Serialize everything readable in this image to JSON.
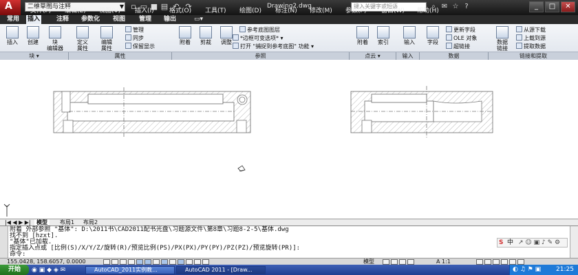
{
  "titlebar": {
    "workspace": "二维草图与注释",
    "document": "Drawing2.dwg",
    "search_placeholder": "键入关键字或短语"
  },
  "menus": [
    "文件(F)",
    "编辑(E)",
    "视图(V)",
    "插入(I)",
    "格式(O)",
    "工具(T)",
    "绘图(D)",
    "标注(N)",
    "修改(M)",
    "参数(P)",
    "窗口(W)",
    "帮助(H)"
  ],
  "tabs": [
    "常用",
    "插入",
    "注释",
    "参数化",
    "视图",
    "管理",
    "输出"
  ],
  "active_tab": "插入",
  "ribbon": {
    "block": {
      "insert": "插入",
      "create": "创建",
      "edit_line1": "块",
      "edit_line2": "编辑器",
      "title": "块"
    },
    "attr": {
      "define_line1": "定义",
      "define_line2": "属性",
      "edit_line1": "编辑",
      "edit_line2": "属性",
      "manage": "管理",
      "sync": "同步",
      "keep": "保留显示",
      "title": "属性"
    },
    "ref": {
      "attach": "附着",
      "clip": "剪裁",
      "adjust": "调整",
      "underlay_layers": "参考底图图层",
      "frame": "*边框可变选项*",
      "snap": "打开 \"捕捉到参考底图\" 功能",
      "title": "参照"
    },
    "pointcloud": {
      "attach": "附着",
      "index": "索引",
      "title": "点云"
    },
    "import": {
      "import": "输入",
      "title": "输入"
    },
    "data": {
      "field": "字段",
      "update_field": "更新字段",
      "ole": "OLE 对象",
      "hyperlink": "超链接",
      "title": "数据"
    },
    "link": {
      "link_line1": "数据",
      "link_line2": "链接",
      "download": "从源下载",
      "upload": "上载到源",
      "extract": "提取数据",
      "title": "链接和提取"
    }
  },
  "layout_tabs": [
    "模型",
    "布局1",
    "布局2"
  ],
  "command_lines": [
    "附着 外部参照 \"基体\": D:\\2011书\\CAD2011配书光盘\\习题源文件\\第8章\\习题8-2-5\\基体.dwg",
    "找不到 [hzxt].",
    "\"基体\"已加载.",
    "指定插入点或 [比例(S)/X/Y/Z/旋转(R)/预览比例(PS)/PX(PX)/PY(PY)/PZ(PZ)/预览旋转(PR)]:",
    "命令:"
  ],
  "ime": "中",
  "status": {
    "coords": "155.0428, 158.6057, 0.0000",
    "model": "模型",
    "scale": "A 1:1"
  },
  "taskbar": {
    "start": "开始",
    "tasks": [
      "AutoCAD_2011实例教...",
      "AutoCAD 2011 - [Draw..."
    ],
    "clock": "21:25"
  }
}
